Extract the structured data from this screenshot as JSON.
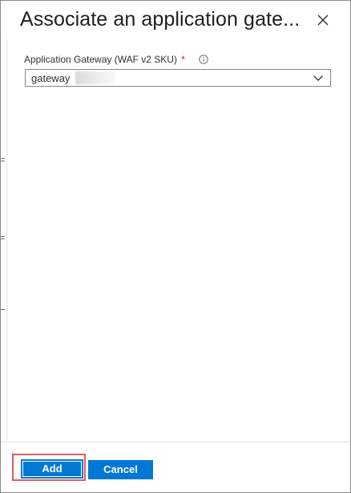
{
  "panel": {
    "title": "Associate an application gate...",
    "close_icon": "close-icon"
  },
  "form": {
    "gateway_field": {
      "label": "Application Gateway (WAF v2 SKU)",
      "required_marker": "*",
      "info_icon": "info-icon",
      "selected_value": "gateway",
      "dropdown_icon": "chevron-down-icon"
    }
  },
  "footer": {
    "add_label": "Add",
    "cancel_label": "Cancel"
  },
  "colors": {
    "primary": "#0078d4",
    "required": "#a4262c",
    "highlight": "#e05c5c"
  }
}
